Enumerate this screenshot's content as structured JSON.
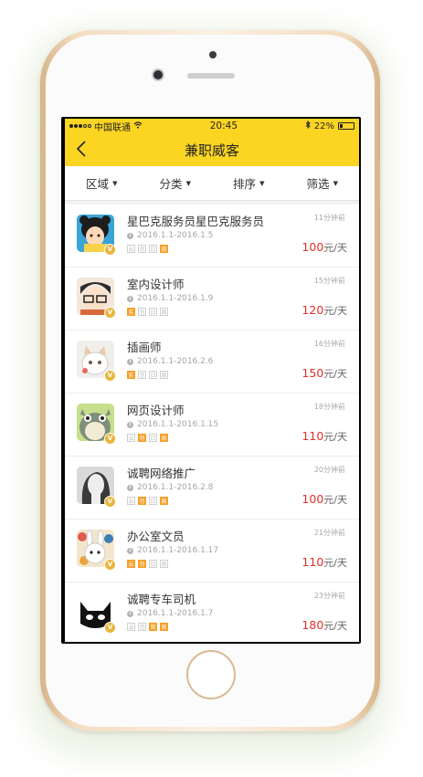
{
  "status_bar": {
    "carrier": "中国联通",
    "time": "20:45",
    "battery": "22%"
  },
  "nav": {
    "title": "兼职威客",
    "back_icon": "chevron-left-icon"
  },
  "filters": [
    {
      "label": "区域"
    },
    {
      "label": "分类"
    },
    {
      "label": "排序"
    },
    {
      "label": "筛选"
    }
  ],
  "colors": {
    "accent": "#fcd522",
    "price": "#e0302a",
    "tag_active": "#f5a027"
  },
  "jobs": [
    {
      "title": "星巴克服务员星巴克服务员",
      "date": "2016.1.1-2016.1.5",
      "ago": "11分钟前",
      "price": "100",
      "unit": "元/天",
      "tags": [
        "云",
        "勿",
        "日",
        "周"
      ],
      "active": [
        3
      ],
      "avatar": "panda-girl"
    },
    {
      "title": "室内设计师",
      "date": "2016.1.1-2016.1.9",
      "ago": "15分钟前",
      "price": "120",
      "unit": "元/天",
      "tags": [
        "实",
        "勿",
        "日",
        "周"
      ],
      "active": [
        0
      ],
      "avatar": "glasses-boy"
    },
    {
      "title": "插画师",
      "date": "2016.1.1-2016.2.6",
      "ago": "16分钟前",
      "price": "150",
      "unit": "元/天",
      "tags": [
        "实",
        "勿",
        "日",
        "周"
      ],
      "active": [
        0
      ],
      "avatar": "cat"
    },
    {
      "title": "网页设计师",
      "date": "2016.1.1-2016.1.15",
      "ago": "18分钟前",
      "price": "110",
      "unit": "元/天",
      "tags": [
        "云",
        "勿",
        "日",
        "周"
      ],
      "active": [
        1,
        3
      ],
      "avatar": "totoro"
    },
    {
      "title": "诚聘网络推广",
      "date": "2016.1.1-2016.2.8",
      "ago": "20分钟前",
      "price": "100",
      "unit": "元/天",
      "tags": [
        "云",
        "勿",
        "日",
        "周"
      ],
      "active": [
        1,
        3
      ],
      "avatar": "woman-portrait"
    },
    {
      "title": "办公室文员",
      "date": "2016.1.1-2016.1.17",
      "ago": "21分钟前",
      "price": "110",
      "unit": "元/天",
      "tags": [
        "云",
        "勿",
        "日",
        "周"
      ],
      "active": [
        0,
        1
      ],
      "avatar": "rabbit"
    },
    {
      "title": "诚聘专车司机",
      "date": "2016.1.1-2016.1.7",
      "ago": "23分钟前",
      "price": "180",
      "unit": "元/天",
      "tags": [
        "云",
        "勿",
        "官",
        "周"
      ],
      "active": [
        2,
        3
      ],
      "avatar": "black-cat"
    }
  ]
}
